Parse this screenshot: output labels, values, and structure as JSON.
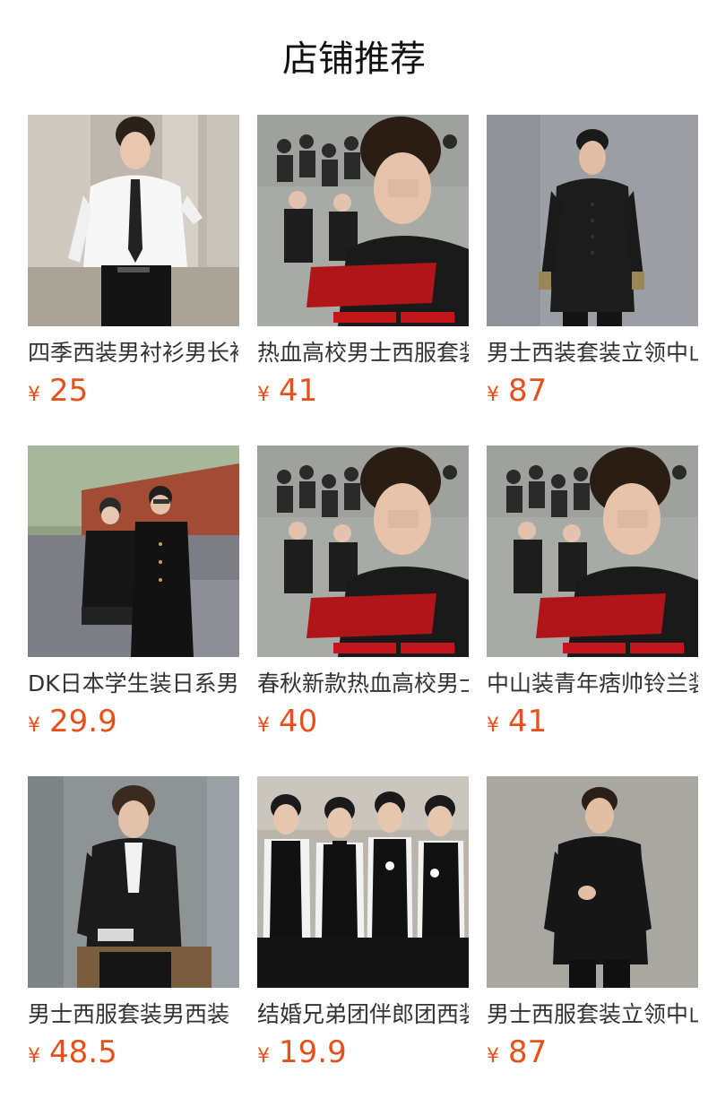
{
  "section": {
    "title": "店铺推荐"
  },
  "products": [
    {
      "name": "四季西装男衬衫男长袖",
      "currency": "¥",
      "price": "25",
      "image": "white-shirt-tie-model"
    },
    {
      "name": "热血高校男士西服套装",
      "currency": "¥",
      "price": "41",
      "image": "ko-one-poster"
    },
    {
      "name": "男士西装套装立领中山装",
      "currency": "¥",
      "price": "87",
      "image": "black-mandarin-suit"
    },
    {
      "name": "DK日本学生装日系男",
      "currency": "¥",
      "price": "29.9",
      "image": "student-uniform-couple"
    },
    {
      "name": "春秋新款热血高校男士",
      "currency": "¥",
      "price": "40",
      "image": "ko-one-poster"
    },
    {
      "name": "中山装青年痞帅铃兰装",
      "currency": "¥",
      "price": "41",
      "image": "ko-one-poster"
    },
    {
      "name": "男士西服套装男西装",
      "currency": "¥",
      "price": "48.5",
      "image": "black-blazer-model"
    },
    {
      "name": "结婚兄弟团伴郎团西装",
      "currency": "¥",
      "price": "19.9",
      "image": "groomsmen-vest-group"
    },
    {
      "name": "男士西服套装立领中山装",
      "currency": "¥",
      "price": "87",
      "image": "black-stand-collar-suit"
    }
  ]
}
